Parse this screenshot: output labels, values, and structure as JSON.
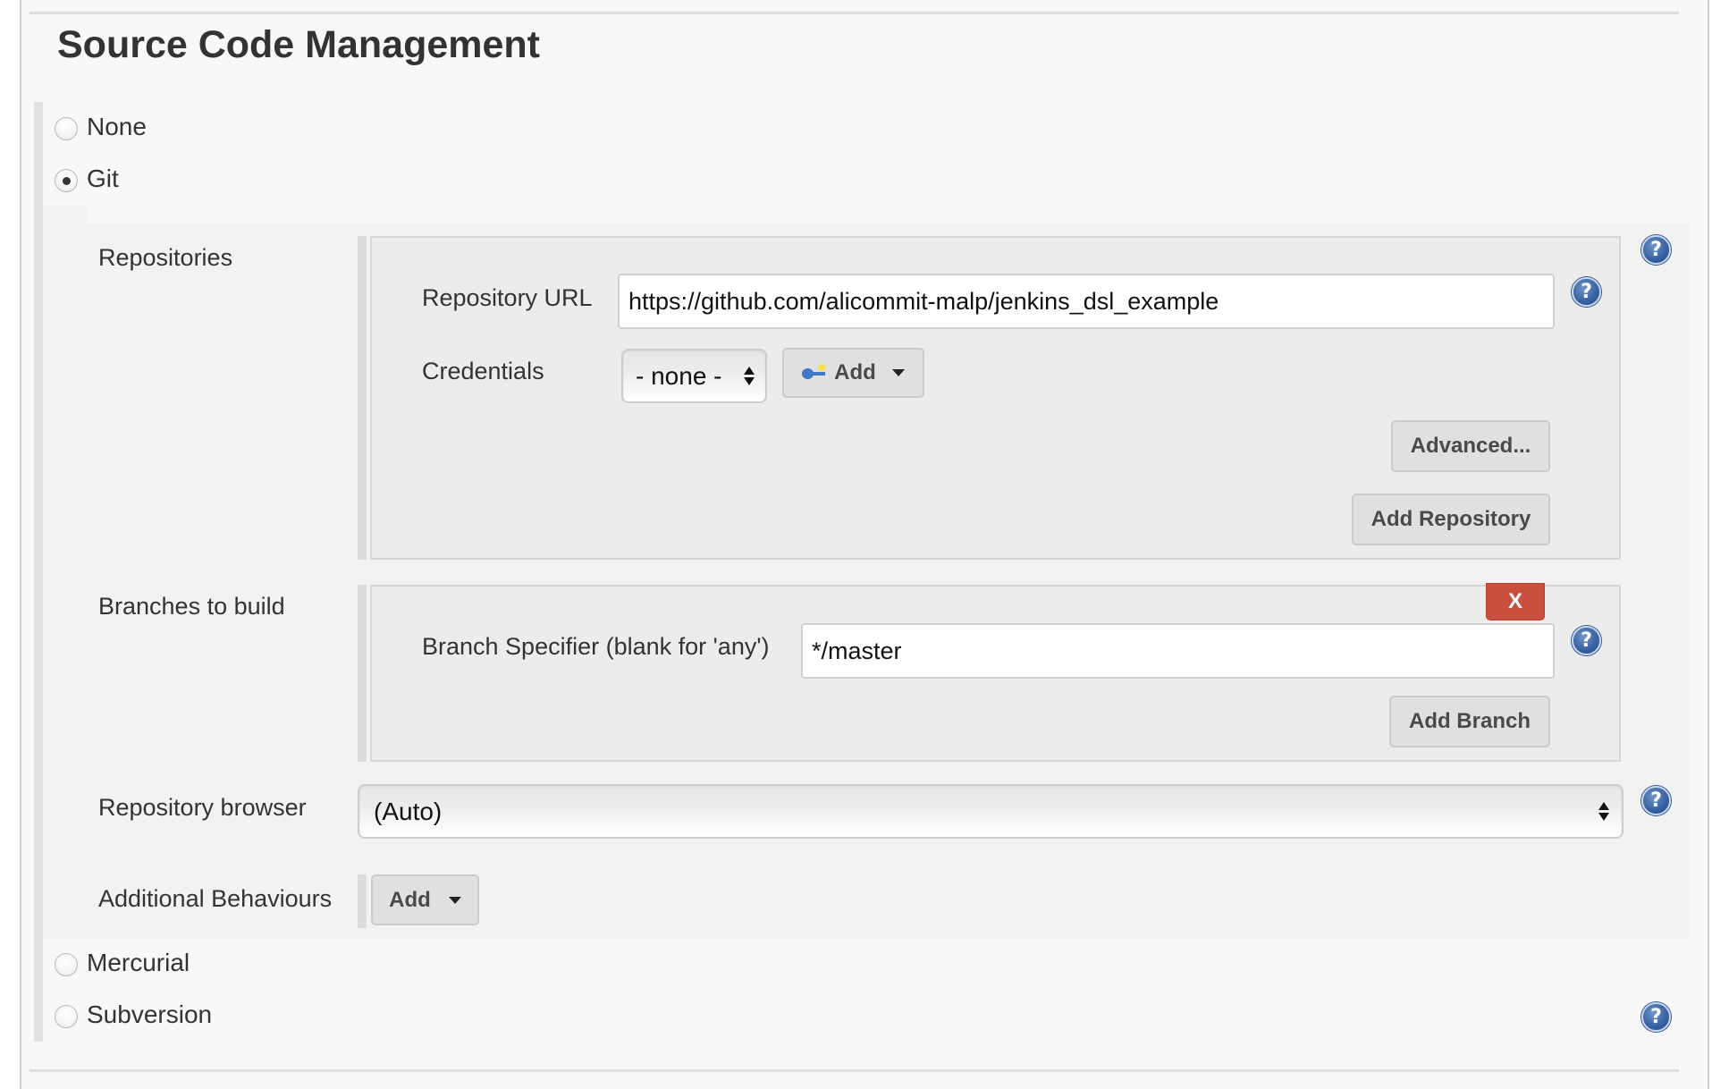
{
  "section": {
    "title": "Source Code Management"
  },
  "scm_options": [
    {
      "label": "None",
      "selected": false
    },
    {
      "label": "Git",
      "selected": true
    },
    {
      "label": "Mercurial",
      "selected": false
    },
    {
      "label": "Subversion",
      "selected": false
    }
  ],
  "git": {
    "repositories": {
      "label": "Repositories",
      "repository_url_label": "Repository URL",
      "repository_url_value": "https://github.com/alicommit-malp/jenkins_dsl_example",
      "credentials_label": "Credentials",
      "credentials_selected": "- none -",
      "credentials_add_label": "Add",
      "advanced_label": "Advanced...",
      "add_repository_label": "Add Repository"
    },
    "branches": {
      "label": "Branches to build",
      "delete_label": "X",
      "branch_specifier_label": "Branch Specifier (blank for 'any')",
      "branch_specifier_value": "*/master",
      "add_branch_label": "Add Branch"
    },
    "repository_browser": {
      "label": "Repository browser",
      "selected": "(Auto)"
    },
    "additional_behaviours": {
      "label": "Additional Behaviours",
      "add_label": "Add"
    }
  },
  "icons": {
    "help": "?",
    "help_icon_name": "help-icon",
    "credentials_icon_name": "key-icon"
  },
  "colors": {
    "delete_button": "#c94f3e",
    "help_icon": "#3a64a3",
    "panel_bg": "#ececec",
    "section_bg": "#f2f2f2"
  }
}
